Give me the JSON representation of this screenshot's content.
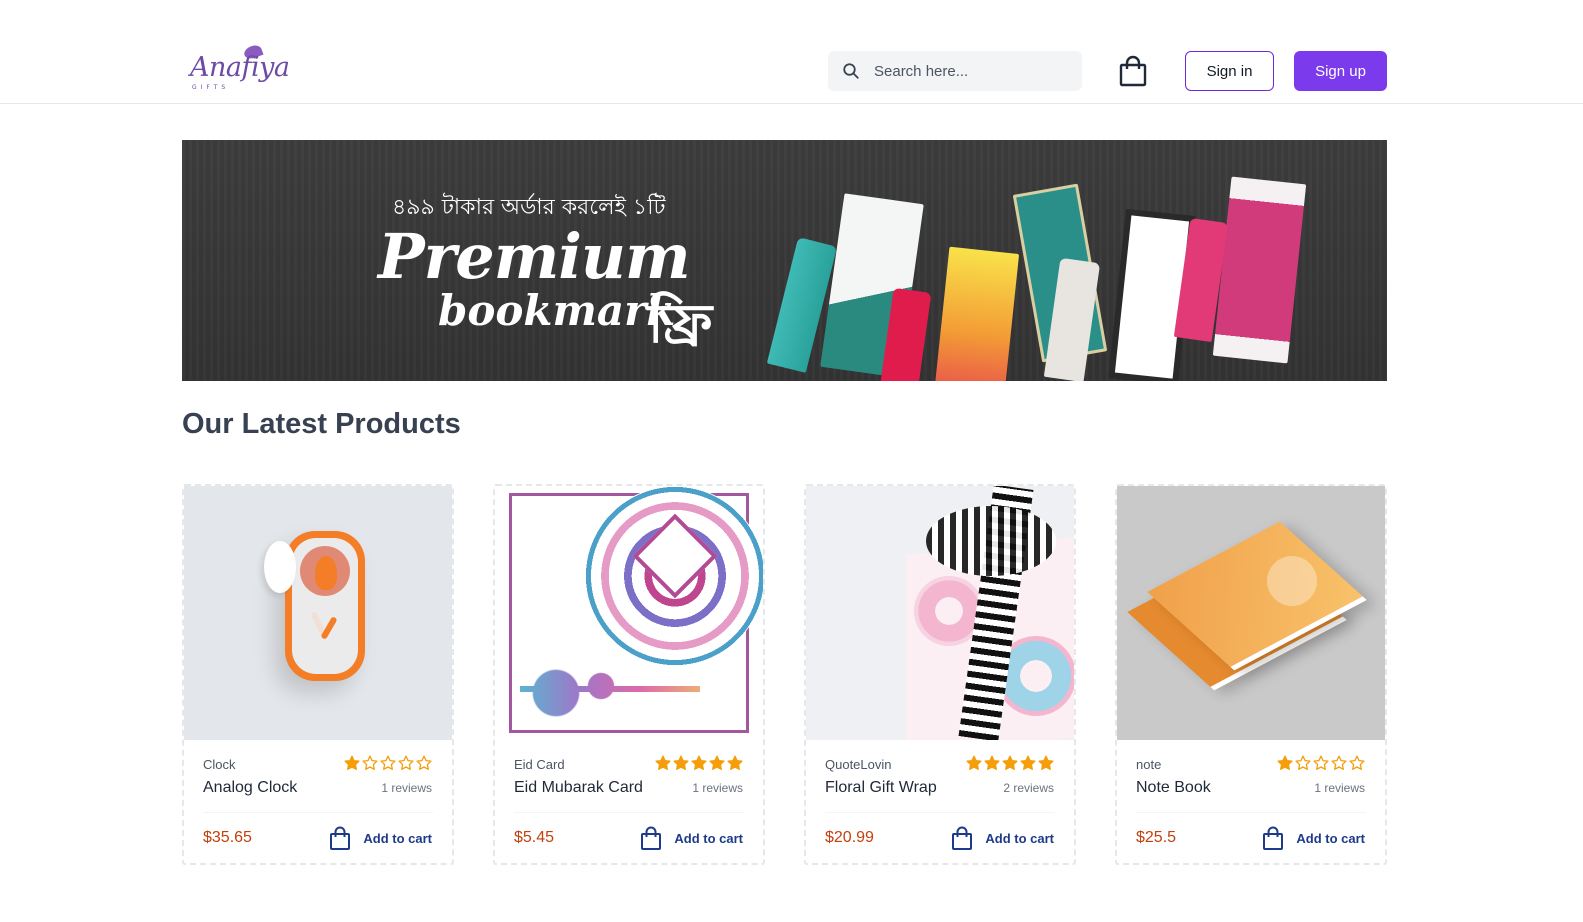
{
  "header": {
    "logo_text": "Anafiya",
    "logo_sub": "GIFTS",
    "search_placeholder": "Search here...",
    "sign_in": "Sign in",
    "sign_up": "Sign up"
  },
  "banner": {
    "line1": "৪৯৯ টাকার অর্ডার করলেই ১টি",
    "line2": "Premium",
    "line3": "bookmark",
    "line4": "ফ্রি"
  },
  "section": {
    "title": "Our Latest Products"
  },
  "products": [
    {
      "category": "Clock",
      "title": "Analog Clock",
      "rating": 1,
      "reviews": "1 reviews",
      "price": "$35.65",
      "add_label": "Add to cart"
    },
    {
      "category": "Eid Card",
      "title": "Eid Mubarak Card",
      "rating": 5,
      "reviews": "1 reviews",
      "price": "$5.45",
      "add_label": "Add to cart"
    },
    {
      "category": "QuoteLovin",
      "title": "Floral Gift Wrap",
      "rating": 5,
      "reviews": "2 reviews",
      "price": "$20.99",
      "add_label": "Add to cart"
    },
    {
      "category": "note",
      "title": "Note Book",
      "rating": 1,
      "reviews": "1 reviews",
      "price": "$25.5",
      "add_label": "Add to cart"
    }
  ],
  "colors": {
    "accent": "#7c3aed",
    "star": "#f59e0b",
    "price": "#c2410c",
    "cart_text": "#1e3a8a"
  }
}
